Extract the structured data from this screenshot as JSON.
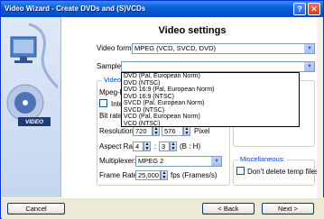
{
  "window": {
    "title": "Video Wizard - Create DVDs and (S)VCDs",
    "help": "?",
    "close": "✕"
  },
  "sidebar": {
    "badge": "VIDEO"
  },
  "page": {
    "title": "Video settings"
  },
  "video_format": {
    "label": "Video format:",
    "value": "MPEG (VCD, SVCD, DVD)"
  },
  "sample": {
    "label": "Sample:",
    "options": [
      "DVD (Pal, European Norm)",
      "DVD (NTSC)",
      "DVD 16:9 (Pal, European Norm)",
      "DVD 16:9 (NTSC)",
      "SVCD (Pal, European Norm)",
      "SVCD (NTSC)",
      "VCD (Pal, European Norm)",
      "VCD (NTSC)"
    ]
  },
  "video_group": {
    "title": "Video:",
    "mpeg_label": "Mpeg-Fo",
    "interlace_label": "Interl",
    "bitrate_label": "Bit rate:",
    "resolution_label": "Resolution:",
    "res_w": "720",
    "res_h": "576",
    "pixel_label": "Pixel",
    "aspect_label": "Aspect Ratio:",
    "aspect_a": "4",
    "aspect_sep": ":",
    "aspect_b": "3",
    "aspect_hint": "(B : H)",
    "multiplexer_label": "Multiplexer:",
    "multiplexer_value": "MPEG 2",
    "framerate_label": "Frame Rate:",
    "framerate_value": "25,000",
    "framerate_unit": "fps (Frames/s)"
  },
  "misc": {
    "title": "Miscellaneous:",
    "dont_delete_label": "Don't delete temp files"
  },
  "footer": {
    "cancel": "Cancel",
    "back": "< Back",
    "next": "Next >"
  }
}
